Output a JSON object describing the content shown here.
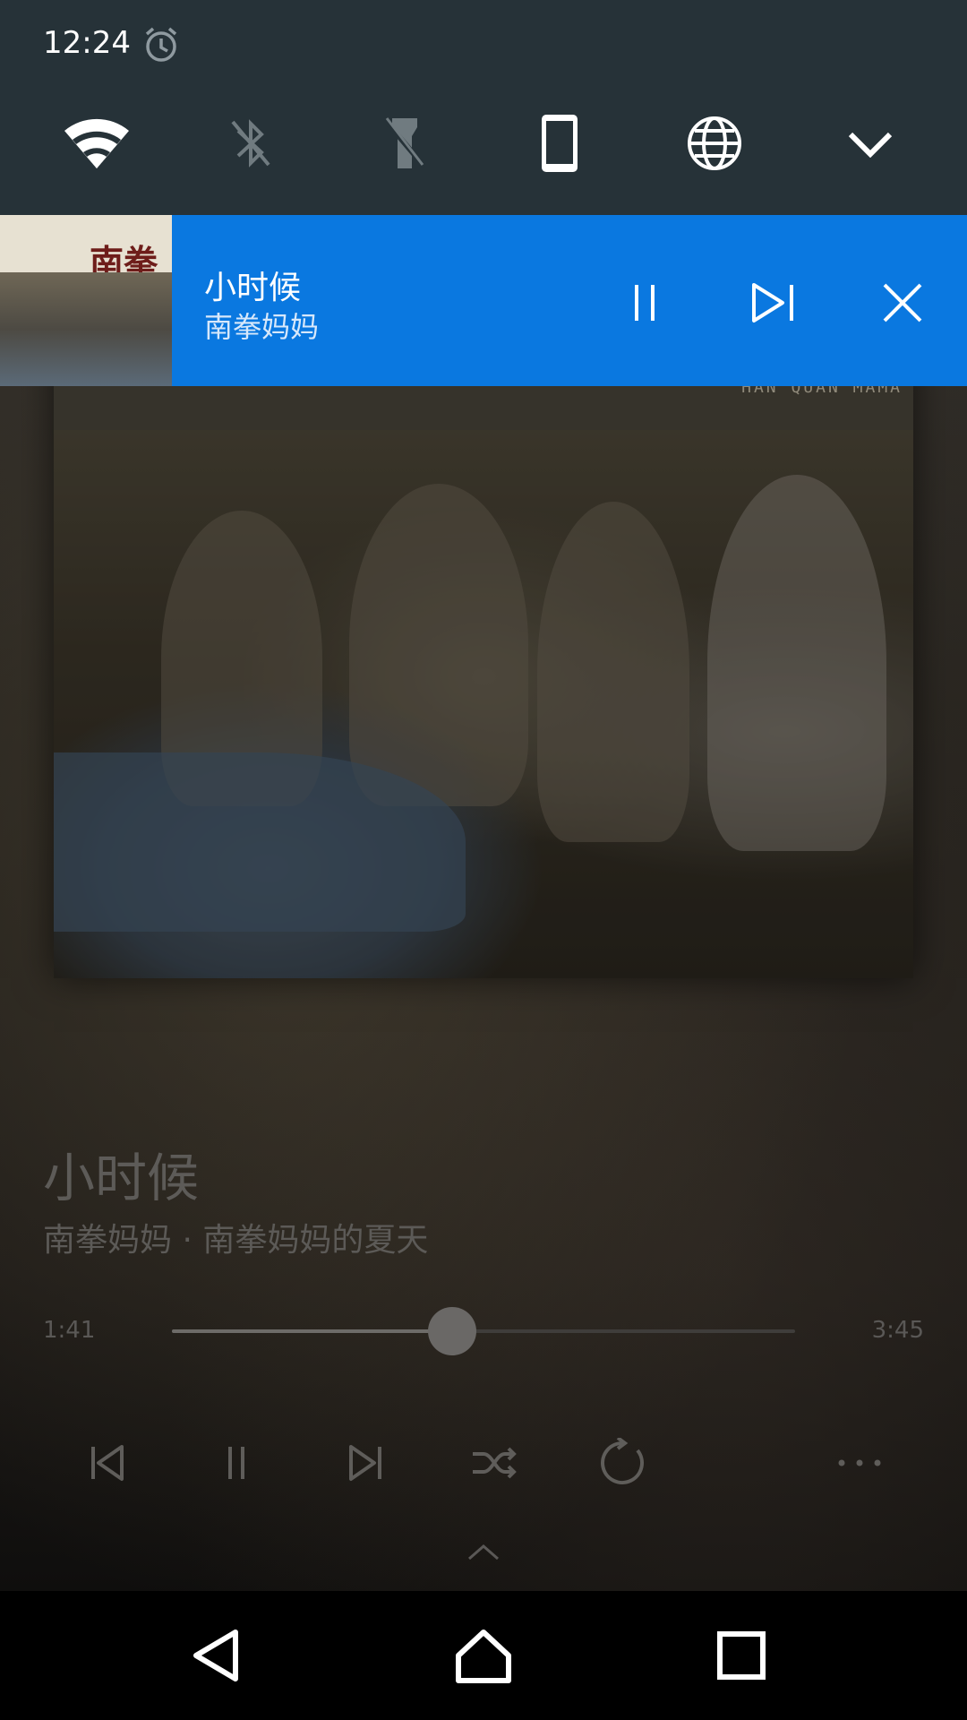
{
  "status_bar": {
    "time": "12:24",
    "alarm_icon": "alarm-clock-icon"
  },
  "quick_settings": {
    "tiles": [
      {
        "name": "wifi",
        "icon": "wifi-icon",
        "state": "on"
      },
      {
        "name": "bluetooth",
        "icon": "bluetooth-off-icon",
        "state": "off"
      },
      {
        "name": "flashlight",
        "icon": "flashlight-off-icon",
        "state": "off"
      },
      {
        "name": "rotation",
        "icon": "phone-portrait-icon",
        "state": "on"
      },
      {
        "name": "network",
        "icon": "globe-icon",
        "state": "on"
      },
      {
        "name": "expand",
        "icon": "chevron-down-icon",
        "state": "on"
      }
    ]
  },
  "notification": {
    "title": "小时候",
    "artist": "南拳妈妈",
    "art_title": "南拳",
    "accent_color": "#0a78e0",
    "buttons": [
      "pause-icon",
      "skip-next-icon",
      "close-icon"
    ]
  },
  "album_art": {
    "caption": "HAN QUAN MAMA"
  },
  "player": {
    "song_title": "小时候",
    "song_meta": "南拳妈妈 · 南拳妈妈的夏天",
    "time_current": "1:41",
    "time_total": "3:45",
    "progress_fraction": 0.449,
    "controls": [
      "skip-previous-icon",
      "pause-icon",
      "skip-next-icon",
      "shuffle-icon",
      "repeat-icon",
      "more-icon"
    ]
  },
  "navigation_bar": {
    "buttons": [
      "back-icon",
      "home-icon",
      "recents-icon"
    ]
  }
}
